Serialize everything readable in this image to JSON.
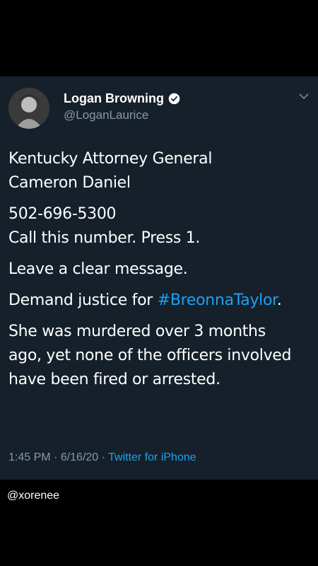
{
  "author": {
    "display_name": "Logan Browning",
    "handle": "@LoganLaurice",
    "verified": true
  },
  "tweet": {
    "lines": [
      [
        "Kentucky Attorney General",
        "Cameron Daniel"
      ],
      [
        "502-696-5300",
        "Call this number. Press 1."
      ],
      [
        "Leave a clear message."
      ]
    ],
    "demand_prefix": "Demand justice for ",
    "hashtag": "#BreonnaTaylor",
    "demand_suffix": ".",
    "closing": [
      "She was murdered over 3 months",
      "ago, yet none of the officers involved",
      "have been fired or arrested."
    ]
  },
  "meta": {
    "time": "1:45 PM",
    "sep1": " · ",
    "date": "6/16/20",
    "sep2": " · ",
    "source": "Twitter for iPhone"
  },
  "watermark": "@xorenee",
  "colors": {
    "card_bg": "#15202b",
    "link": "#1da1f2",
    "secondary_text": "#8899a6",
    "page_bg": "#000000"
  },
  "icons": {
    "verified": "verified-badge-icon",
    "menu": "chevron-down-icon"
  }
}
